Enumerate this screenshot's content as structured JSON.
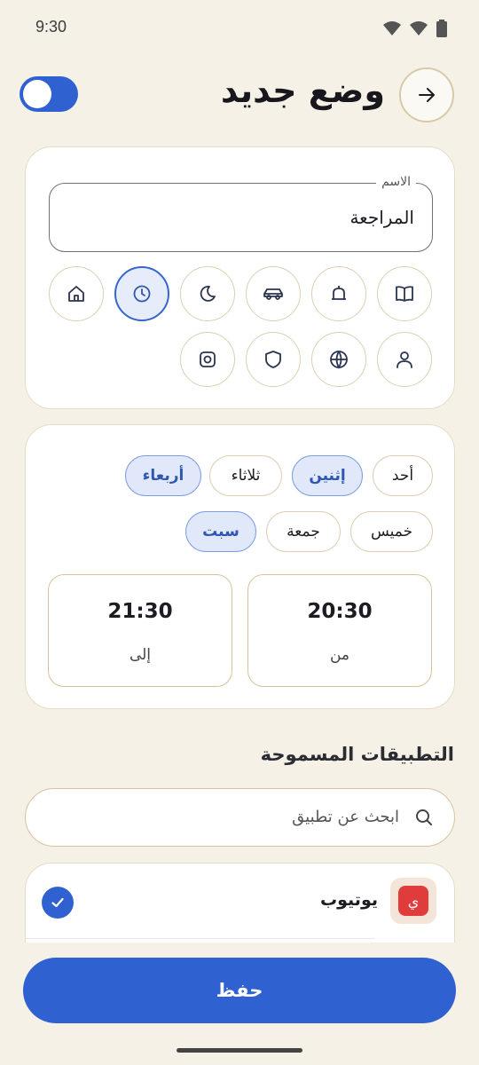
{
  "status": {
    "time": "9:30"
  },
  "header": {
    "title": "وضع جديد",
    "enabled": true
  },
  "mode": {
    "name_label": "الاسم",
    "name_value": "المراجعة",
    "icons": [
      "book-icon",
      "bell-icon",
      "car-icon",
      "moon-icon",
      "clock-icon",
      "home-icon",
      "person-icon",
      "globe-icon",
      "shield-icon",
      "instagram-icon"
    ],
    "selected_icon": "clock-icon"
  },
  "schedule": {
    "days": [
      {
        "label": "أحد",
        "selected": false
      },
      {
        "label": "إثنين",
        "selected": true
      },
      {
        "label": "ثلاثاء",
        "selected": false
      },
      {
        "label": "أربعاء",
        "selected": true
      },
      {
        "label": "خميس",
        "selected": false
      },
      {
        "label": "جمعة",
        "selected": false
      },
      {
        "label": "سبت",
        "selected": true
      }
    ],
    "from": {
      "label": "من",
      "value": "20:30"
    },
    "to": {
      "label": "إلى",
      "value": "21:30"
    }
  },
  "apps": {
    "title": "التطبيقات المسموحة",
    "search_placeholder": "ابحث عن تطبيق",
    "items": [
      {
        "name": "يوتيوب",
        "icon_letter": "ي",
        "checked": true
      }
    ]
  },
  "save_label": "حفظ",
  "colors": {
    "accent": "#2f61d0",
    "background": "#f6f1e6"
  }
}
